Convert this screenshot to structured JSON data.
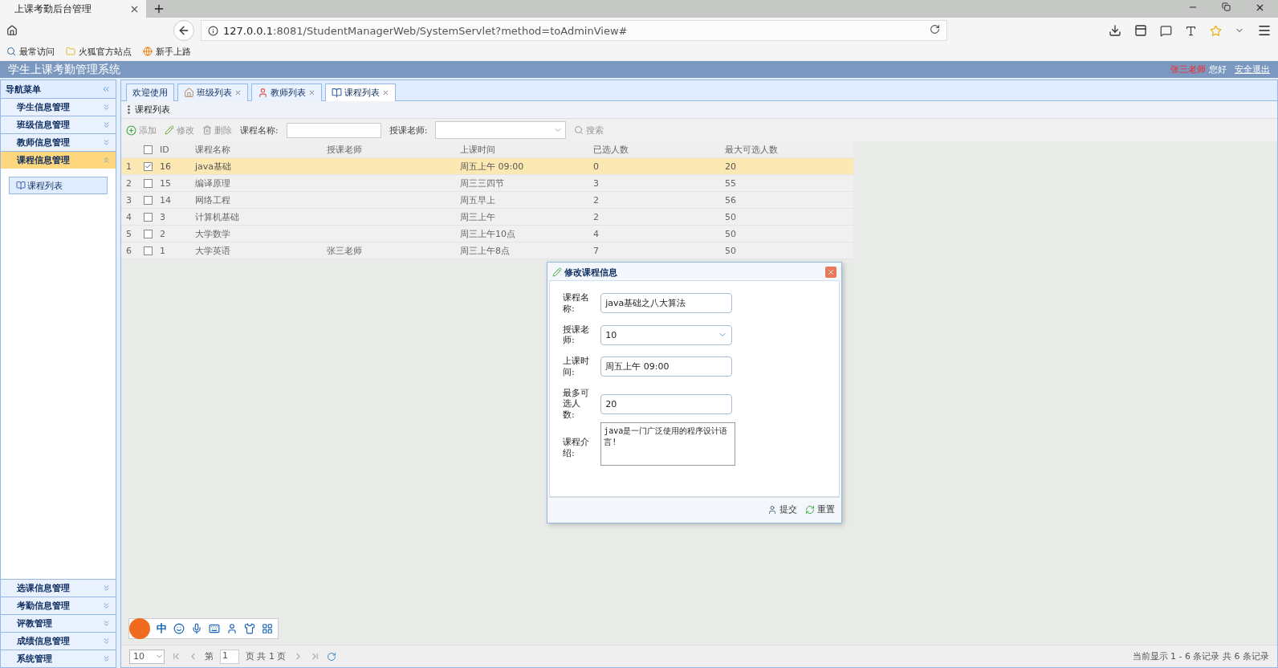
{
  "browser": {
    "tab_title": "上课考勤后台管理",
    "url_host": "127.0.0.1",
    "url_rest": ":8081/StudentManagerWeb/SystemServlet?method=toAdminView#",
    "bookmarks": [
      {
        "label": "最常访问",
        "kind": "search"
      },
      {
        "label": "火狐官方站点",
        "kind": "folder"
      },
      {
        "label": "新手上路",
        "kind": "globe"
      }
    ]
  },
  "app": {
    "title": "学生上课考勤管理系统",
    "user_name": "张三老师",
    "greeting": "您好",
    "logout": "安全退出"
  },
  "sidebar": {
    "title": "导航菜单",
    "sections": [
      {
        "label": "学生信息管理",
        "expanded": false
      },
      {
        "label": "班级信息管理",
        "expanded": false
      },
      {
        "label": "教师信息管理",
        "expanded": false
      },
      {
        "label": "课程信息管理",
        "expanded": true,
        "children": [
          {
            "label": "课程列表",
            "selected": true
          }
        ]
      },
      {
        "label": "选课信息管理",
        "expanded": false
      },
      {
        "label": "考勤信息管理",
        "expanded": false
      },
      {
        "label": "评教管理",
        "expanded": false
      },
      {
        "label": "成绩信息管理",
        "expanded": false
      },
      {
        "label": "系统管理",
        "expanded": false
      }
    ]
  },
  "tabs": [
    {
      "label": "欢迎使用",
      "kind": "welcome",
      "closable": false,
      "selected": false
    },
    {
      "label": "班级列表",
      "kind": "class",
      "closable": true,
      "selected": false
    },
    {
      "label": "教师列表",
      "kind": "teacher",
      "closable": true,
      "selected": false
    },
    {
      "label": "课程列表",
      "kind": "course",
      "closable": true,
      "selected": true
    }
  ],
  "panel_title": "课程列表",
  "toolbar": {
    "buttons": [
      {
        "label": "添加",
        "kind": "add"
      },
      {
        "label": "修改",
        "kind": "edit"
      },
      {
        "label": "删除",
        "kind": "delete"
      }
    ],
    "name_label": "课程名称:",
    "teacher_label": "授课老师:",
    "search": "搜索"
  },
  "table": {
    "all_checked": false,
    "columns": [
      "ID",
      "课程名称",
      "授课老师",
      "上课时间",
      "已选人数",
      "最大可选人数"
    ],
    "rows": [
      {
        "index": "1",
        "checked": true,
        "selected": true,
        "cells": [
          "16",
          "java基础",
          "",
          "周五上午 09:00",
          "0",
          "20"
        ]
      },
      {
        "index": "2",
        "checked": false,
        "selected": false,
        "cells": [
          "15",
          "编译原理",
          "",
          "周三三四节",
          "3",
          "55"
        ]
      },
      {
        "index": "3",
        "checked": false,
        "selected": false,
        "cells": [
          "14",
          "网络工程",
          "",
          "周五早上",
          "2",
          "56"
        ]
      },
      {
        "index": "4",
        "checked": false,
        "selected": false,
        "cells": [
          "3",
          "计算机基础",
          "",
          "周三上午",
          "2",
          "50"
        ]
      },
      {
        "index": "5",
        "checked": false,
        "selected": false,
        "cells": [
          "2",
          "大学数学",
          "",
          "周三上午10点",
          "4",
          "50"
        ]
      },
      {
        "index": "6",
        "checked": false,
        "selected": false,
        "cells": [
          "1",
          "大学英语",
          "张三老师",
          "周三上午8点",
          "7",
          "50"
        ]
      }
    ]
  },
  "dialog": {
    "title": "修改课程信息",
    "fields": [
      {
        "label": "课程名称:",
        "kind": "text",
        "value": "java基础之八大算法"
      },
      {
        "label": "授课老师:",
        "kind": "select",
        "value": "10"
      },
      {
        "label": "上课时间:",
        "kind": "text",
        "value": "周五上午 09:00"
      },
      {
        "label": "最多可选人数:",
        "kind": "text",
        "value": "20"
      },
      {
        "label": "课程介绍:",
        "kind": "textarea",
        "value": "java是一门广泛使用的程序设计语言!"
      }
    ],
    "buttons": [
      {
        "label": "提交",
        "kind": "submit"
      },
      {
        "label": "重置",
        "kind": "reset"
      }
    ]
  },
  "pager": {
    "page_size": "10",
    "page_prefix": "第",
    "page": "1",
    "page_suffix": "页 共 1 页",
    "info": "当前显示 1 - 6 条记录 共 6 条记录"
  },
  "ime": {
    "label": "中"
  }
}
